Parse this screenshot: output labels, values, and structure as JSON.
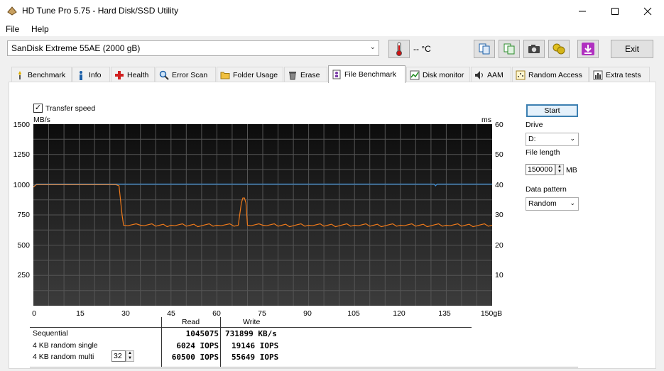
{
  "window": {
    "title": "HD Tune Pro 5.75 - Hard Disk/SSD Utility"
  },
  "menu": {
    "file": "File",
    "help": "Help"
  },
  "toolbar": {
    "drive": "SanDisk Extreme 55AE (2000 gB)",
    "temperature": "-- °C",
    "exit_label": "Exit"
  },
  "tabs": [
    {
      "label": "Benchmark",
      "icon": "benchmark-icon"
    },
    {
      "label": "Info",
      "icon": "info-icon"
    },
    {
      "label": "Health",
      "icon": "health-icon"
    },
    {
      "label": "Error Scan",
      "icon": "error-scan-icon"
    },
    {
      "label": "Folder Usage",
      "icon": "folder-icon"
    },
    {
      "label": "Erase",
      "icon": "erase-icon"
    },
    {
      "label": "File Benchmark",
      "icon": "file-benchmark-icon"
    },
    {
      "label": "Disk monitor",
      "icon": "disk-monitor-icon"
    },
    {
      "label": "AAM",
      "icon": "aam-icon"
    },
    {
      "label": "Random Access",
      "icon": "random-access-icon"
    },
    {
      "label": "Extra tests",
      "icon": "extra-tests-icon"
    }
  ],
  "benchmark": {
    "transfer_speed_label": "Transfer speed",
    "transfer_speed_checked": true,
    "start_label": "Start",
    "drive_label": "Drive",
    "drive_value": "D:",
    "file_length_label": "File length",
    "file_length_value": "150000",
    "file_length_unit": "MB",
    "data_pattern_label": "Data pattern",
    "data_pattern_value": "Random"
  },
  "chart_data": {
    "type": "line",
    "left_unit": "MB/s",
    "right_unit": "ms",
    "x_unit": "gB",
    "xlim": [
      0,
      150
    ],
    "ylim": [
      0,
      1500
    ],
    "y2lim": [
      0,
      60
    ],
    "x_ticks": [
      "0",
      "15",
      "30",
      "45",
      "60",
      "75",
      "90",
      "105",
      "120",
      "135",
      "150gB"
    ],
    "y_ticks": [
      "1500",
      "1250",
      "1000",
      "750",
      "500",
      "250"
    ],
    "y2_ticks": [
      "60",
      "50",
      "40",
      "30",
      "20",
      "10"
    ],
    "grid": true,
    "series": [
      {
        "color": "#3a8fd9",
        "x": [
          0,
          1,
          130,
          131,
          131.5,
          132,
          150
        ],
        "y": [
          980,
          1005,
          1005,
          1005,
          990,
          1005,
          1005
        ]
      },
      {
        "color": "#f07a1a",
        "x": [
          0,
          1,
          10,
          20,
          27,
          28,
          29,
          29.5,
          35,
          45,
          60,
          67,
          68,
          68.5,
          69,
          69.5,
          70,
          75,
          90,
          105,
          120,
          135,
          150
        ],
        "y": [
          980,
          1000,
          1000,
          1000,
          1000,
          990,
          750,
          665,
          665,
          665,
          665,
          665,
          850,
          890,
          890,
          850,
          665,
          665,
          665,
          665,
          665,
          665,
          665
        ]
      }
    ]
  },
  "results": {
    "read_header": "Read",
    "write_header": "Write",
    "rows": [
      {
        "label": "Sequential",
        "read": "1045075",
        "write": "731899 KB/s"
      },
      {
        "label": "4 KB random single",
        "read": "6024 IOPS",
        "write": "19146 IOPS"
      },
      {
        "label": "4 KB random multi",
        "read": "60500 IOPS",
        "write": "55649 IOPS"
      }
    ],
    "queue_depth": "32"
  }
}
